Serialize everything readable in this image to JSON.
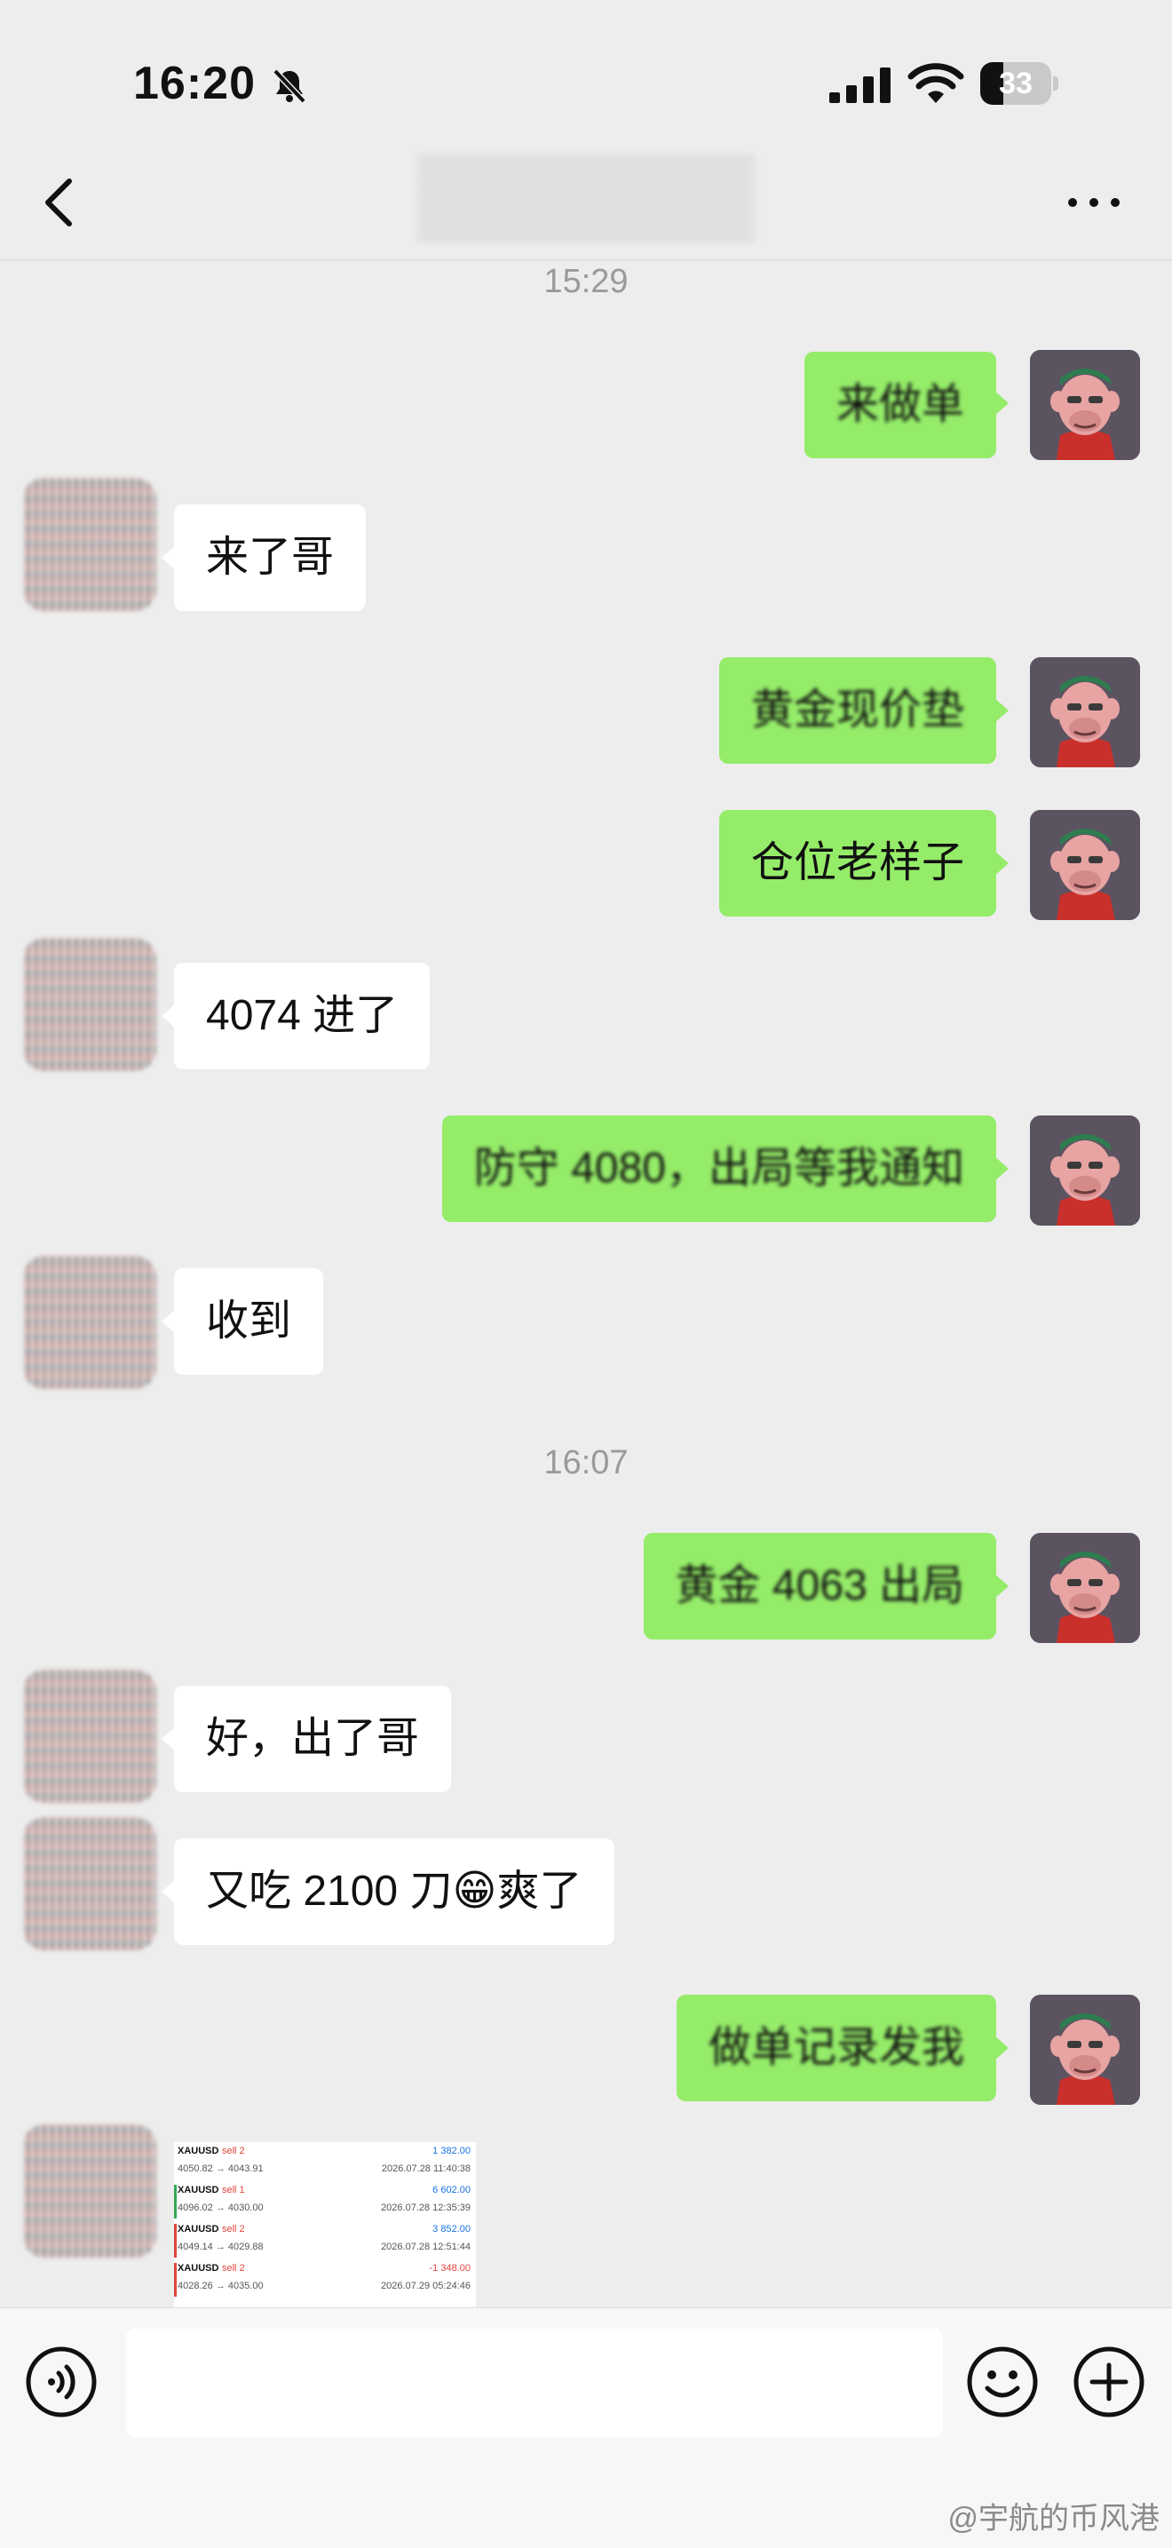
{
  "status_bar": {
    "time": "16:20",
    "battery_level": "33",
    "battery_fraction": 0.33
  },
  "nav": {
    "title": "",
    "icons": {
      "back": "chevron-left-icon",
      "more": "more-horizontal-icon"
    }
  },
  "messages": {
    "ts1": "15:29",
    "m1": "来做单",
    "m2": "来了哥",
    "m3": "黄金现价垫",
    "m4": "仓位老样子",
    "m5": "4074 进了",
    "m6": "防守 4080，出局等我通知",
    "m7": "收到",
    "ts2": "16:07",
    "m8": "黄金 4063 出局",
    "m9": "好，出了哥",
    "m10_before": "又吃 2100 刀",
    "m10_emoji": "😁",
    "m10_after": "爽了",
    "m11": "做单记录发我"
  },
  "trade_record": {
    "rows": [
      {
        "symbol": "XAUUSD",
        "side": "sell 2",
        "profit": "1 382.00",
        "prices": "4050.82 → 4043.91",
        "time": "2026.07.28 11:40:38"
      },
      {
        "symbol": "XAUUSD",
        "side": "sell 1",
        "profit": "6 602.00",
        "prices": "4096.02 → 4030.00",
        "time": "2026.07.28 12:35:39"
      },
      {
        "symbol": "XAUUSD",
        "side": "sell 2",
        "profit": "3 852.00",
        "prices": "4049.14 → 4029.88",
        "time": "2026.07.28 12:51:44"
      },
      {
        "symbol": "XAUUSD",
        "side": "sell 2",
        "profit": "-1 348.00",
        "prices": "4028.26 → 4035.00",
        "time": "2026.07.29 05:24:46"
      }
    ],
    "colors": {
      "profit_positive": "#1a73e8",
      "profit_negative": "#e0433a",
      "bar_green": "#34a853",
      "bar_red": "#e0433a"
    }
  },
  "input_bar": {
    "placeholder": "",
    "icons": {
      "voice": "voice-icon",
      "emoji": "emoji-icon",
      "plus": "plus-icon"
    }
  },
  "watermark": "@宇航的币风港",
  "colors": {
    "bubble_self": "#95ec69",
    "bubble_other": "#ffffff",
    "background": "#ededed"
  }
}
